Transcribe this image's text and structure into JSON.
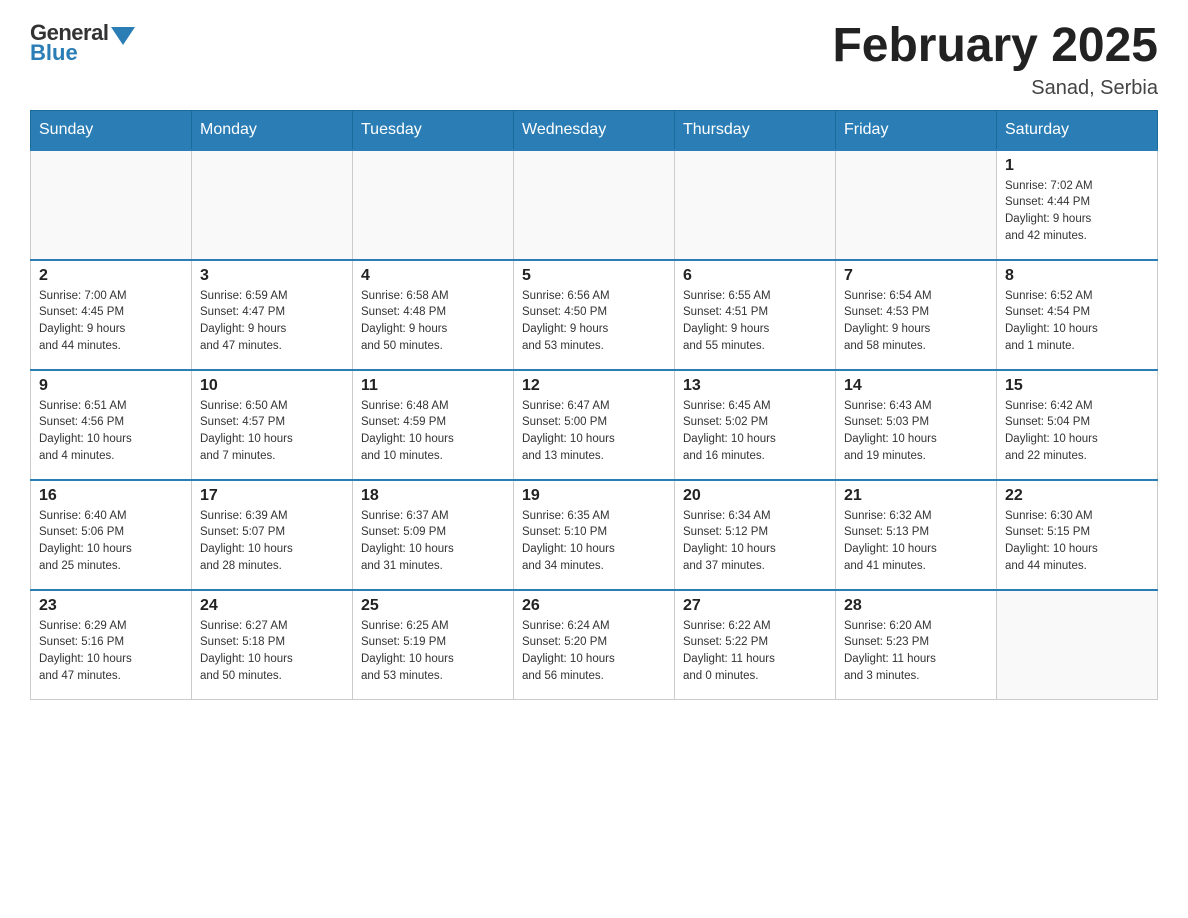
{
  "header": {
    "logo_general": "General",
    "logo_blue": "Blue",
    "month_title": "February 2025",
    "location": "Sanad, Serbia"
  },
  "weekdays": [
    "Sunday",
    "Monday",
    "Tuesday",
    "Wednesday",
    "Thursday",
    "Friday",
    "Saturday"
  ],
  "weeks": [
    [
      {
        "day": "",
        "info": ""
      },
      {
        "day": "",
        "info": ""
      },
      {
        "day": "",
        "info": ""
      },
      {
        "day": "",
        "info": ""
      },
      {
        "day": "",
        "info": ""
      },
      {
        "day": "",
        "info": ""
      },
      {
        "day": "1",
        "info": "Sunrise: 7:02 AM\nSunset: 4:44 PM\nDaylight: 9 hours\nand 42 minutes."
      }
    ],
    [
      {
        "day": "2",
        "info": "Sunrise: 7:00 AM\nSunset: 4:45 PM\nDaylight: 9 hours\nand 44 minutes."
      },
      {
        "day": "3",
        "info": "Sunrise: 6:59 AM\nSunset: 4:47 PM\nDaylight: 9 hours\nand 47 minutes."
      },
      {
        "day": "4",
        "info": "Sunrise: 6:58 AM\nSunset: 4:48 PM\nDaylight: 9 hours\nand 50 minutes."
      },
      {
        "day": "5",
        "info": "Sunrise: 6:56 AM\nSunset: 4:50 PM\nDaylight: 9 hours\nand 53 minutes."
      },
      {
        "day": "6",
        "info": "Sunrise: 6:55 AM\nSunset: 4:51 PM\nDaylight: 9 hours\nand 55 minutes."
      },
      {
        "day": "7",
        "info": "Sunrise: 6:54 AM\nSunset: 4:53 PM\nDaylight: 9 hours\nand 58 minutes."
      },
      {
        "day": "8",
        "info": "Sunrise: 6:52 AM\nSunset: 4:54 PM\nDaylight: 10 hours\nand 1 minute."
      }
    ],
    [
      {
        "day": "9",
        "info": "Sunrise: 6:51 AM\nSunset: 4:56 PM\nDaylight: 10 hours\nand 4 minutes."
      },
      {
        "day": "10",
        "info": "Sunrise: 6:50 AM\nSunset: 4:57 PM\nDaylight: 10 hours\nand 7 minutes."
      },
      {
        "day": "11",
        "info": "Sunrise: 6:48 AM\nSunset: 4:59 PM\nDaylight: 10 hours\nand 10 minutes."
      },
      {
        "day": "12",
        "info": "Sunrise: 6:47 AM\nSunset: 5:00 PM\nDaylight: 10 hours\nand 13 minutes."
      },
      {
        "day": "13",
        "info": "Sunrise: 6:45 AM\nSunset: 5:02 PM\nDaylight: 10 hours\nand 16 minutes."
      },
      {
        "day": "14",
        "info": "Sunrise: 6:43 AM\nSunset: 5:03 PM\nDaylight: 10 hours\nand 19 minutes."
      },
      {
        "day": "15",
        "info": "Sunrise: 6:42 AM\nSunset: 5:04 PM\nDaylight: 10 hours\nand 22 minutes."
      }
    ],
    [
      {
        "day": "16",
        "info": "Sunrise: 6:40 AM\nSunset: 5:06 PM\nDaylight: 10 hours\nand 25 minutes."
      },
      {
        "day": "17",
        "info": "Sunrise: 6:39 AM\nSunset: 5:07 PM\nDaylight: 10 hours\nand 28 minutes."
      },
      {
        "day": "18",
        "info": "Sunrise: 6:37 AM\nSunset: 5:09 PM\nDaylight: 10 hours\nand 31 minutes."
      },
      {
        "day": "19",
        "info": "Sunrise: 6:35 AM\nSunset: 5:10 PM\nDaylight: 10 hours\nand 34 minutes."
      },
      {
        "day": "20",
        "info": "Sunrise: 6:34 AM\nSunset: 5:12 PM\nDaylight: 10 hours\nand 37 minutes."
      },
      {
        "day": "21",
        "info": "Sunrise: 6:32 AM\nSunset: 5:13 PM\nDaylight: 10 hours\nand 41 minutes."
      },
      {
        "day": "22",
        "info": "Sunrise: 6:30 AM\nSunset: 5:15 PM\nDaylight: 10 hours\nand 44 minutes."
      }
    ],
    [
      {
        "day": "23",
        "info": "Sunrise: 6:29 AM\nSunset: 5:16 PM\nDaylight: 10 hours\nand 47 minutes."
      },
      {
        "day": "24",
        "info": "Sunrise: 6:27 AM\nSunset: 5:18 PM\nDaylight: 10 hours\nand 50 minutes."
      },
      {
        "day": "25",
        "info": "Sunrise: 6:25 AM\nSunset: 5:19 PM\nDaylight: 10 hours\nand 53 minutes."
      },
      {
        "day": "26",
        "info": "Sunrise: 6:24 AM\nSunset: 5:20 PM\nDaylight: 10 hours\nand 56 minutes."
      },
      {
        "day": "27",
        "info": "Sunrise: 6:22 AM\nSunset: 5:22 PM\nDaylight: 11 hours\nand 0 minutes."
      },
      {
        "day": "28",
        "info": "Sunrise: 6:20 AM\nSunset: 5:23 PM\nDaylight: 11 hours\nand 3 minutes."
      },
      {
        "day": "",
        "info": ""
      }
    ]
  ]
}
